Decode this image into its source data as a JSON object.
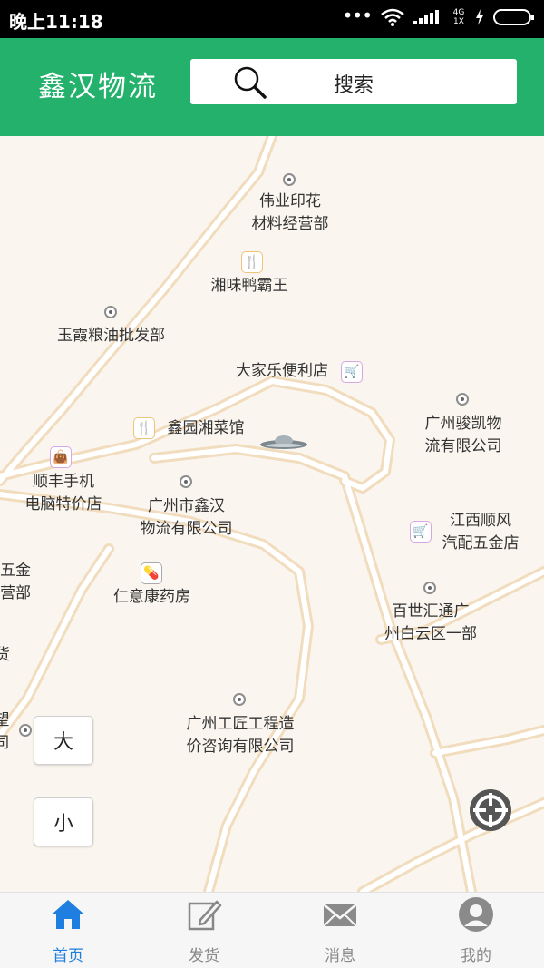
{
  "status_bar": {
    "time": "晚上11:18",
    "network": "4G 1X"
  },
  "header": {
    "title": "鑫汉物流",
    "search_label": "搜索"
  },
  "map": {
    "pois": [
      {
        "id": "weiye",
        "label": "伟业印花\n材料经营部",
        "icon": "map-pin-icon"
      },
      {
        "id": "xiangwei",
        "label": "湘味鸭霸王",
        "icon": "restaurant-icon"
      },
      {
        "id": "yuxia",
        "label": "玉霞粮油批发部",
        "icon": "map-pin-icon"
      },
      {
        "id": "dajiale",
        "label": "大家乐便利店",
        "icon": "shopping-cart-icon"
      },
      {
        "id": "junkai",
        "label": "广州骏凯物\n流有限公司",
        "icon": "map-pin-icon"
      },
      {
        "id": "xinyuan",
        "label": "鑫园湘菜馆",
        "icon": "restaurant-icon"
      },
      {
        "id": "shunfeng_phone",
        "label": "顺丰手机\n电脑特价店",
        "icon": "shopping-bag-icon"
      },
      {
        "id": "xinhan",
        "label": "广州市鑫汉\n物流有限公司",
        "icon": "map-pin-icon"
      },
      {
        "id": "jiangxi",
        "label": "江西顺风\n汽配五金店",
        "icon": "shopping-cart-icon"
      },
      {
        "id": "wujin_partial",
        "label": "五金\n营部",
        "icon": ""
      },
      {
        "id": "renyi",
        "label": "仁意康药房",
        "icon": "pill-icon"
      },
      {
        "id": "baishi",
        "label": "百世汇通广\n州白云区一部",
        "icon": "map-pin-icon"
      },
      {
        "id": "partial_huo",
        "label": "货",
        "icon": ""
      },
      {
        "id": "partial_wang",
        "label": "望\n司",
        "icon": "map-pin-icon"
      },
      {
        "id": "gongjiang",
        "label": "广州工匠工程造\n价咨询有限公司",
        "icon": "map-pin-icon"
      }
    ],
    "zoom_in_label": "大",
    "zoom_out_label": "小"
  },
  "tabs": [
    {
      "label": "首页",
      "icon": "home-icon",
      "active": true
    },
    {
      "label": "发货",
      "icon": "edit-icon",
      "active": false
    },
    {
      "label": "消息",
      "icon": "mail-icon",
      "active": false
    },
    {
      "label": "我的",
      "icon": "user-icon",
      "active": false
    }
  ],
  "colors": {
    "header": "#23b16b",
    "active_tab": "#1e7fe0",
    "map_bg": "#faf6ef",
    "road": "#f6e3c7"
  }
}
